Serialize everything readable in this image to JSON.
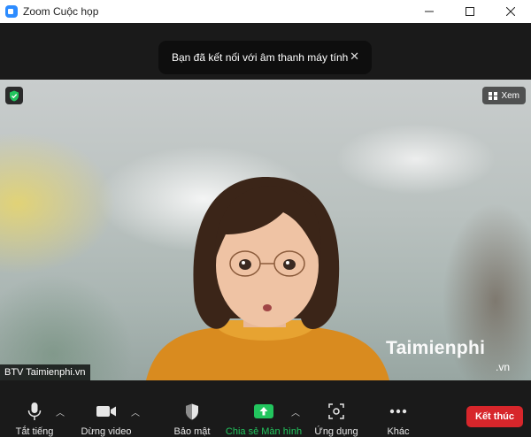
{
  "window": {
    "title": "Zoom Cuộc họp",
    "controls": [
      "minimize",
      "maximize",
      "close"
    ]
  },
  "toast": {
    "message": "Bạn đã kết nối với âm thanh máy tính",
    "close_icon": "close-icon"
  },
  "video": {
    "security_badge_icon": "shield-check-icon",
    "view_button_label": "Xem",
    "participant_name": "BTV Taimienphi.vn",
    "watermark": "Taimienphi",
    "watermark_sub": ".vn"
  },
  "toolbar": {
    "mute_label": "Tắt tiếng",
    "video_label": "Dừng video",
    "security_label": "Bảo mật",
    "share_label": "Chia sẻ Màn hình",
    "apps_label": "Ứng dụng",
    "more_label": "Khác",
    "end_label": "Kết thúc"
  },
  "colors": {
    "share_accent": "#22c55e",
    "end_button": "#d7262b",
    "shield": "#22c55e",
    "zoom_blue": "#2d8cff"
  }
}
